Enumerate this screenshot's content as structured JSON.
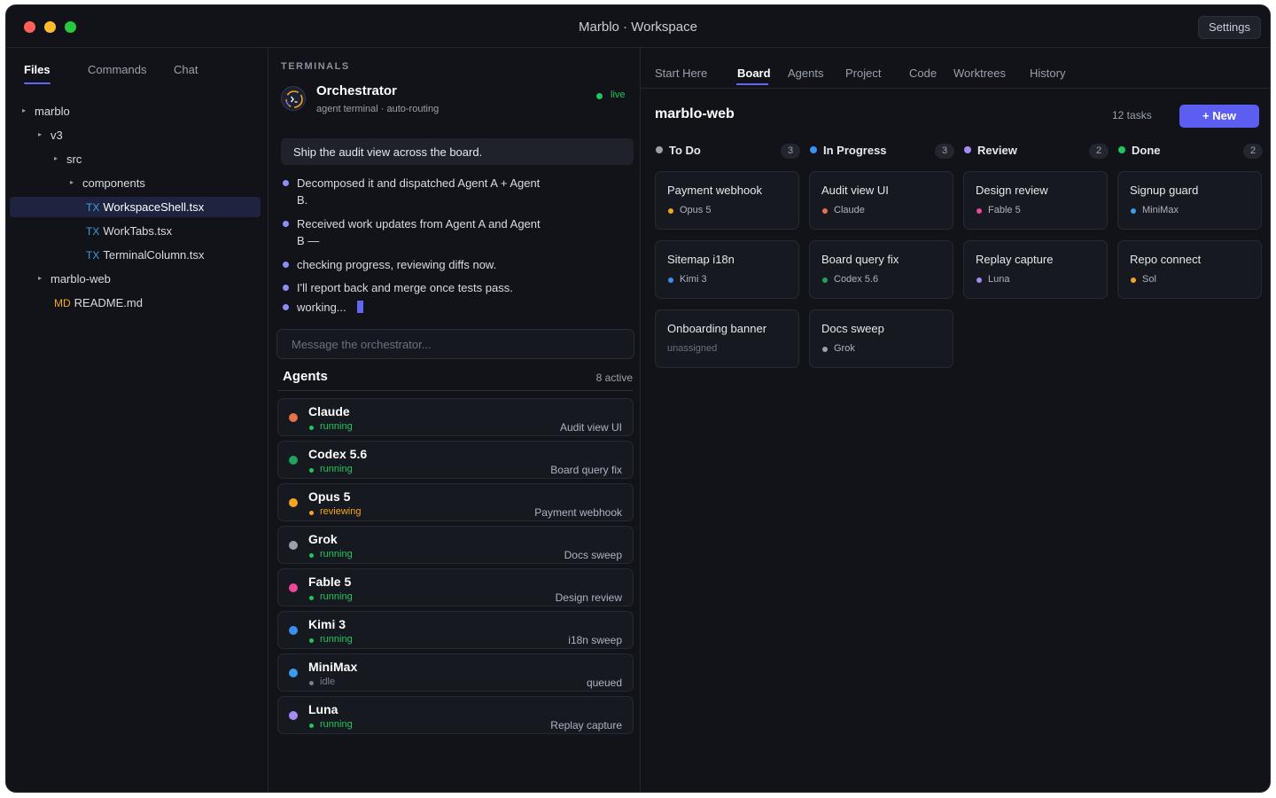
{
  "window": {
    "title": "Marblo · Workspace",
    "settings_label": "Settings"
  },
  "sidebar": {
    "tabs": [
      "Files",
      "Commands",
      "Chat"
    ],
    "tree": [
      {
        "caret": "▸",
        "label": "marblo",
        "badge": ""
      },
      {
        "caret": "▸",
        "label": "v3",
        "badge": ""
      },
      {
        "caret": "▸",
        "label": "src",
        "badge": ""
      },
      {
        "caret": "▸",
        "label": "components",
        "badge": ""
      },
      {
        "caret": "",
        "label": "WorkspaceShell.tsx",
        "badge": "TX"
      },
      {
        "caret": "",
        "label": "WorkTabs.tsx",
        "badge": "TX"
      },
      {
        "caret": "",
        "label": "TerminalColumn.tsx",
        "badge": "TX"
      },
      {
        "caret": "▸",
        "label": "marblo-web",
        "badge": ""
      },
      {
        "caret": "",
        "label": "README.md",
        "badge": "MD"
      }
    ]
  },
  "terminal": {
    "section_label": "TERMINALS",
    "title": "Orchestrator",
    "subtitle": "agent terminal · auto-routing",
    "status": "live",
    "prompt": "Ship the audit view across the board.",
    "log": [
      "Decomposed it and dispatched Agent A + Agent B.",
      "Received work updates from Agent A and Agent B —",
      "checking progress, reviewing diffs now.",
      "I'll report back and merge once tests pass.",
      "working..."
    ],
    "input_placeholder": "Message the orchestrator..."
  },
  "agents": {
    "title": "Agents",
    "count": "8 active",
    "items": [
      {
        "name": "Claude",
        "status": "running",
        "task": "Audit view UI",
        "color": "#e8704a",
        "status_color": "#22c55e"
      },
      {
        "name": "Codex 5.6",
        "status": "running",
        "task": "Board query fix",
        "color": "#22a35a",
        "status_color": "#22c55e"
      },
      {
        "name": "Opus 5",
        "status": "reviewing",
        "task": "Payment webhook",
        "color": "#f5a524",
        "status_color": "#f5a524"
      },
      {
        "name": "Grok",
        "status": "running",
        "task": "Docs sweep",
        "color": "#9ca0aa",
        "status_color": "#22c55e"
      },
      {
        "name": "Fable 5",
        "status": "running",
        "task": "Design review",
        "color": "#ec4899",
        "status_color": "#22c55e"
      },
      {
        "name": "Kimi 3",
        "status": "running",
        "task": "i18n sweep",
        "color": "#3b8ff0",
        "status_color": "#22c55e"
      },
      {
        "name": "MiniMax",
        "status": "idle",
        "task": "queued",
        "color": "#3b9ceb",
        "status_color": "#7a7f8b"
      },
      {
        "name": "Luna",
        "status": "running",
        "task": "Replay capture",
        "color": "#a58cf5",
        "status_color": "#22c55e"
      }
    ]
  },
  "main": {
    "tabs": [
      "Start Here",
      "Board",
      "Agents",
      "Project",
      "Code",
      "Worktrees",
      "History"
    ],
    "active_tab": "Board",
    "board_title": "marblo-web",
    "task_count": "12 tasks",
    "new_button": "+ New",
    "columns": [
      {
        "title": "To Do",
        "count": "3",
        "color": "#9ca0aa",
        "cards": [
          {
            "title": "Payment webhook",
            "assignee": "Opus 5",
            "color": "#f5a524"
          },
          {
            "title": "Sitemap i18n",
            "assignee": "Kimi 3",
            "color": "#3b8ff0"
          },
          {
            "title": "Onboarding banner",
            "assignee": "unassigned",
            "color": ""
          }
        ]
      },
      {
        "title": "In Progress",
        "count": "3",
        "color": "#3b8ff0",
        "cards": [
          {
            "title": "Audit view UI",
            "assignee": "Claude",
            "color": "#e8704a"
          },
          {
            "title": "Board query fix",
            "assignee": "Codex 5.6",
            "color": "#22a35a"
          },
          {
            "title": "Docs sweep",
            "assignee": "Grok",
            "color": "#9ca0aa"
          }
        ]
      },
      {
        "title": "Review",
        "count": "2",
        "color": "#a58cf5",
        "cards": [
          {
            "title": "Design review",
            "assignee": "Fable 5",
            "color": "#ec4899"
          },
          {
            "title": "Replay capture",
            "assignee": "Luna",
            "color": "#a58cf5"
          }
        ]
      },
      {
        "title": "Done",
        "count": "2",
        "color": "#22c55e",
        "cards": [
          {
            "title": "Signup guard",
            "assignee": "MiniMax",
            "color": "#3b9ceb"
          },
          {
            "title": "Repo connect",
            "assignee": "Sol",
            "color": "#f5a524"
          }
        ]
      }
    ]
  },
  "colors": {
    "accent": "#6366f1",
    "background": "#111319",
    "live": "#22c55e"
  }
}
